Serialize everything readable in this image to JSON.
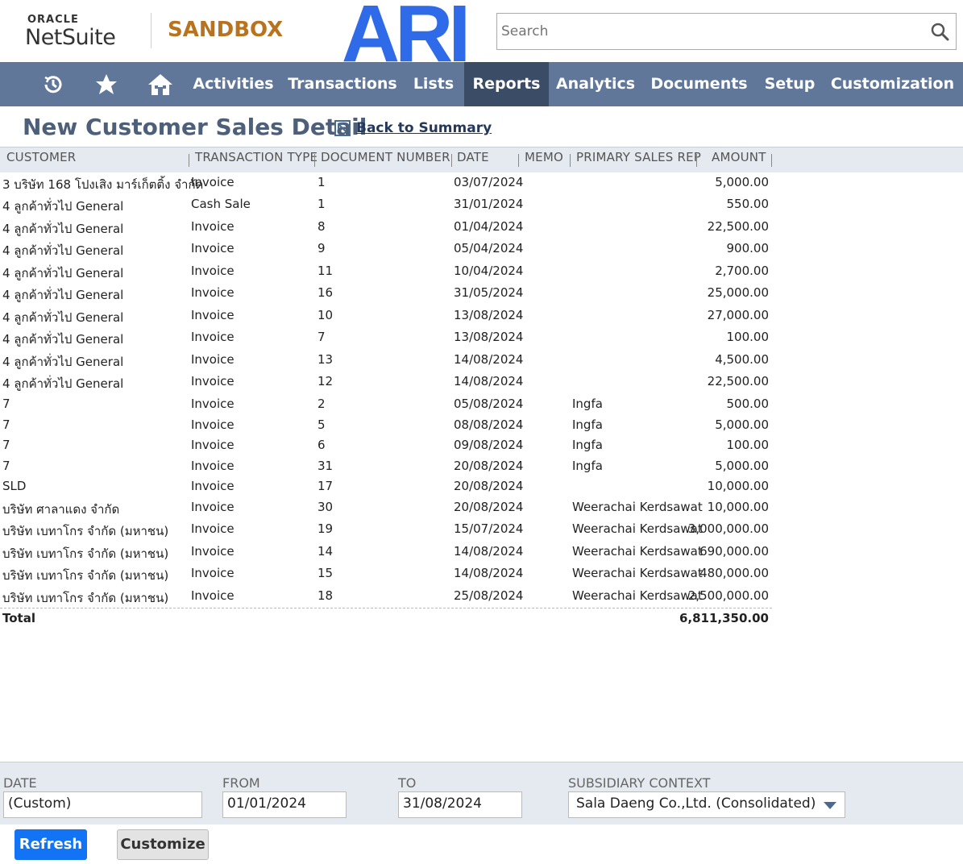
{
  "header": {
    "oracle_label": "ORACLE",
    "netsuite_label": "NetSuite",
    "sandbox_label": "SANDBOX",
    "ari_logo_text": "ARI",
    "search_placeholder": "Search"
  },
  "nav": {
    "items": [
      {
        "label": "Activities"
      },
      {
        "label": "Transactions"
      },
      {
        "label": "Lists"
      },
      {
        "label": "Reports",
        "active": true
      },
      {
        "label": "Analytics"
      },
      {
        "label": "Documents"
      },
      {
        "label": "Setup"
      },
      {
        "label": "Customization"
      }
    ],
    "icons": [
      "recent-icon",
      "star-icon",
      "home-icon"
    ]
  },
  "page": {
    "title": "New Customer Sales Detail",
    "back_link": "Back to Summary"
  },
  "table": {
    "columns": [
      "CUSTOMER",
      "TRANSACTION TYPE",
      "DOCUMENT NUMBER",
      "DATE",
      "MEMO",
      "PRIMARY SALES REP",
      "AMOUNT"
    ],
    "rows": [
      {
        "customer": "3 บริษัท 168 โปงเสิง มาร์เก็ตติ้ง จำกัด",
        "type": "Invoice",
        "doc": "1",
        "date": "03/07/2024",
        "memo": "",
        "rep": "",
        "amount": "5,000.00"
      },
      {
        "customer": "4 ลูกค้าทั่วไป General",
        "type": "Cash Sale",
        "doc": "1",
        "date": "31/01/2024",
        "memo": "",
        "rep": "",
        "amount": "550.00"
      },
      {
        "customer": "4 ลูกค้าทั่วไป General",
        "type": "Invoice",
        "doc": "8",
        "date": "01/04/2024",
        "memo": "",
        "rep": "",
        "amount": "22,500.00"
      },
      {
        "customer": "4 ลูกค้าทั่วไป General",
        "type": "Invoice",
        "doc": "9",
        "date": "05/04/2024",
        "memo": "",
        "rep": "",
        "amount": "900.00"
      },
      {
        "customer": "4 ลูกค้าทั่วไป General",
        "type": "Invoice",
        "doc": "11",
        "date": "10/04/2024",
        "memo": "",
        "rep": "",
        "amount": "2,700.00"
      },
      {
        "customer": "4 ลูกค้าทั่วไป General",
        "type": "Invoice",
        "doc": "16",
        "date": "31/05/2024",
        "memo": "",
        "rep": "",
        "amount": "25,000.00"
      },
      {
        "customer": "4 ลูกค้าทั่วไป General",
        "type": "Invoice",
        "doc": "10",
        "date": "13/08/2024",
        "memo": "",
        "rep": "",
        "amount": "27,000.00"
      },
      {
        "customer": "4 ลูกค้าทั่วไป General",
        "type": "Invoice",
        "doc": "7",
        "date": "13/08/2024",
        "memo": "",
        "rep": "",
        "amount": "100.00"
      },
      {
        "customer": "4 ลูกค้าทั่วไป General",
        "type": "Invoice",
        "doc": "13",
        "date": "14/08/2024",
        "memo": "",
        "rep": "",
        "amount": "4,500.00"
      },
      {
        "customer": "4 ลูกค้าทั่วไป General",
        "type": "Invoice",
        "doc": "12",
        "date": "14/08/2024",
        "memo": "",
        "rep": "",
        "amount": "22,500.00"
      },
      {
        "customer": "7",
        "type": "Invoice",
        "doc": "2",
        "date": "05/08/2024",
        "memo": "",
        "rep": "Ingfa",
        "amount": "500.00"
      },
      {
        "customer": "7",
        "type": "Invoice",
        "doc": "5",
        "date": "08/08/2024",
        "memo": "",
        "rep": "Ingfa",
        "amount": "5,000.00"
      },
      {
        "customer": "7",
        "type": "Invoice",
        "doc": "6",
        "date": "09/08/2024",
        "memo": "",
        "rep": "Ingfa",
        "amount": "100.00"
      },
      {
        "customer": "7",
        "type": "Invoice",
        "doc": "31",
        "date": "20/08/2024",
        "memo": "",
        "rep": "Ingfa",
        "amount": "5,000.00"
      },
      {
        "customer": "SLD",
        "type": "Invoice",
        "doc": "17",
        "date": "20/08/2024",
        "memo": "",
        "rep": "",
        "amount": "10,000.00"
      },
      {
        "customer": "บริษัท ศาลาแดง จำกัด",
        "type": "Invoice",
        "doc": "30",
        "date": "20/08/2024",
        "memo": "",
        "rep": "Weerachai Kerdsawat",
        "amount": "10,000.00"
      },
      {
        "customer": "บริษัท เบทาโกร จำกัด (มหาชน)",
        "type": "Invoice",
        "doc": "19",
        "date": "15/07/2024",
        "memo": "",
        "rep": "Weerachai Kerdsawat",
        "amount": "3,000,000.00"
      },
      {
        "customer": "บริษัท เบทาโกร จำกัด (มหาชน)",
        "type": "Invoice",
        "doc": "14",
        "date": "14/08/2024",
        "memo": "",
        "rep": "Weerachai Kerdsawat",
        "amount": "690,000.00"
      },
      {
        "customer": "บริษัท เบทาโกร จำกัด (มหาชน)",
        "type": "Invoice",
        "doc": "15",
        "date": "14/08/2024",
        "memo": "",
        "rep": "Weerachai Kerdsawat",
        "amount": "480,000.00"
      },
      {
        "customer": "บริษัท เบทาโกร จำกัด (มหาชน)",
        "type": "Invoice",
        "doc": "18",
        "date": "25/08/2024",
        "memo": "",
        "rep": "Weerachai Kerdsawat",
        "amount": "2,500,000.00"
      }
    ],
    "total_label": "Total",
    "total_value": "6,811,350.00"
  },
  "filters": {
    "date_label": "DATE",
    "date_value": "(Custom)",
    "from_label": "FROM",
    "from_value": "01/01/2024",
    "to_label": "TO",
    "to_value": "31/08/2024",
    "subsidiary_label": "SUBSIDIARY CONTEXT",
    "subsidiary_value": "Sala Daeng Co.,Ltd. (Consolidated)"
  },
  "buttons": {
    "refresh": "Refresh",
    "customize": "Customize"
  },
  "colors": {
    "nav_bg": "#607799",
    "nav_active": "#3b4d66",
    "accent_blue": "#1273f4",
    "sandbox": "#b8731e",
    "title": "#4d5f79",
    "ari": "#2f6be8"
  }
}
